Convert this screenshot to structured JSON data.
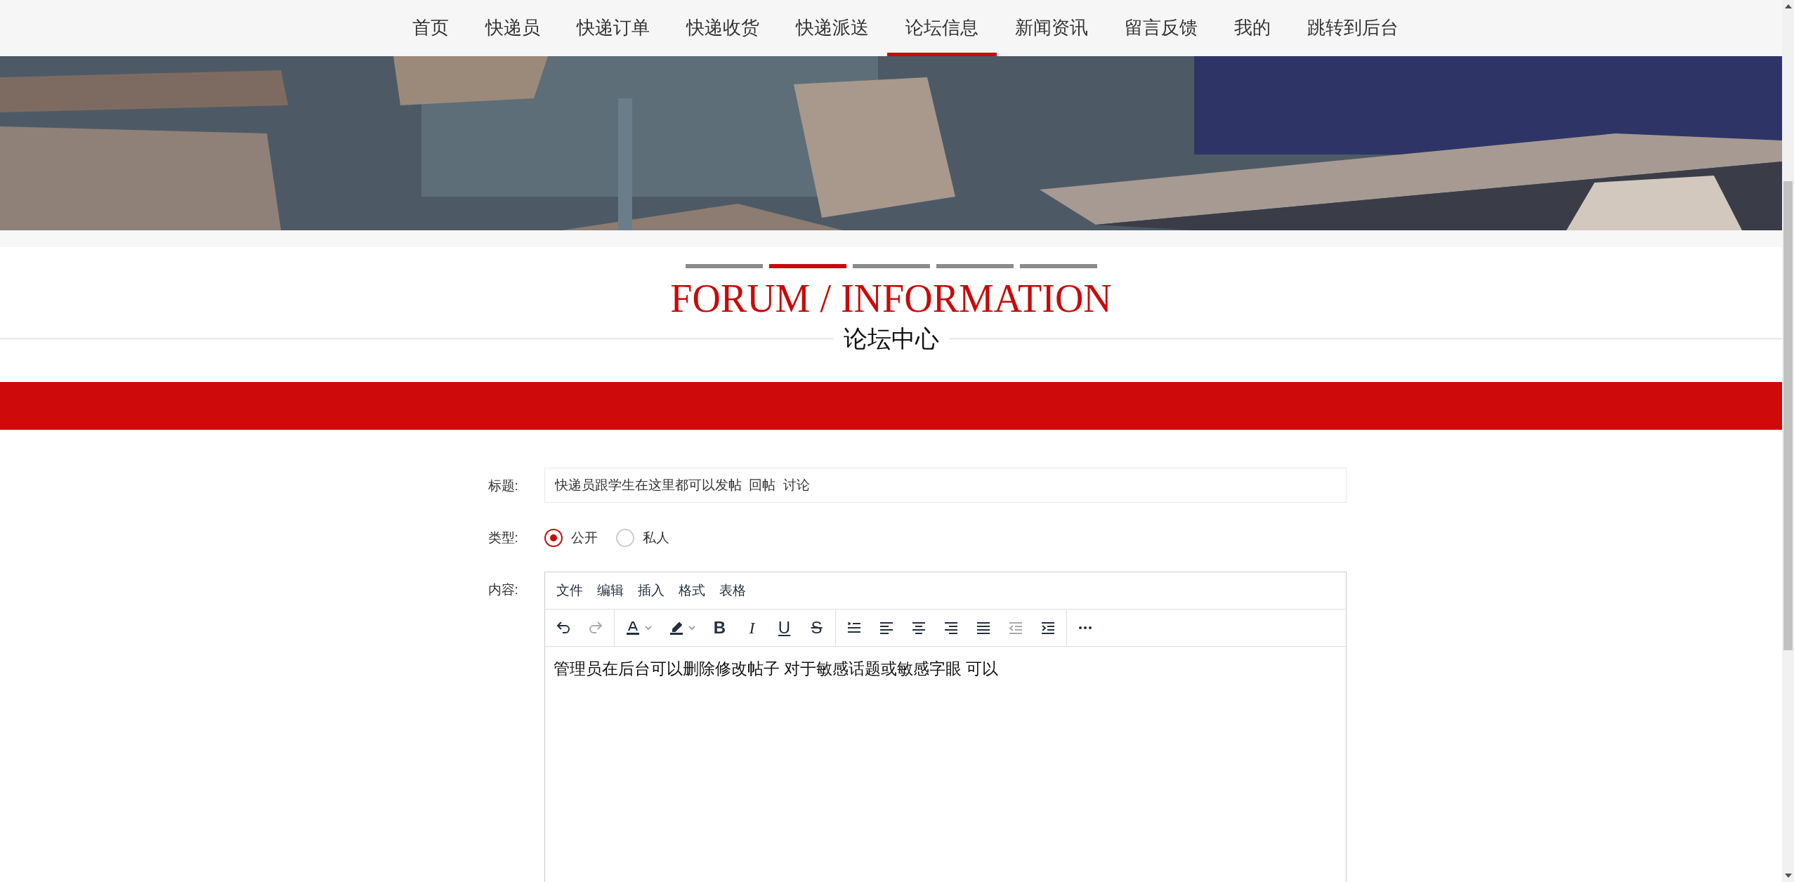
{
  "nav": [
    {
      "label": "首页",
      "selected": false
    },
    {
      "label": "快递员",
      "selected": false
    },
    {
      "label": "快递订单",
      "selected": false
    },
    {
      "label": "快递收货",
      "selected": false
    },
    {
      "label": "快递派送",
      "selected": false
    },
    {
      "label": "论坛信息",
      "selected": true
    },
    {
      "label": "新闻资讯",
      "selected": false
    },
    {
      "label": "留言反馈",
      "selected": false
    },
    {
      "label": "我的",
      "selected": false
    },
    {
      "label": "跳转到后台",
      "selected": false
    }
  ],
  "slide_indicators": [
    {
      "selected": false
    },
    {
      "selected": true
    },
    {
      "selected": false
    },
    {
      "selected": false
    },
    {
      "selected": false
    }
  ],
  "section": {
    "title": "FORUM / INFORMATION",
    "subtitle": "论坛中心"
  },
  "form": {
    "title_label": "标题:",
    "title_value": "快递员跟学生在这里都可以发帖  回帖  讨论",
    "type_label": "类型:",
    "types": [
      {
        "label": "公开",
        "selected": true
      },
      {
        "label": "私人",
        "selected": false
      }
    ],
    "content_label": "内容:",
    "editor": {
      "menu": [
        "文件",
        "编辑",
        "插入",
        "格式",
        "表格"
      ],
      "toolbar": [
        [
          {
            "kind": "undo",
            "disabled": false
          },
          {
            "kind": "redo",
            "disabled": true
          }
        ],
        [
          {
            "kind": "text-color",
            "disabled": false
          },
          {
            "kind": "highlight",
            "disabled": false
          },
          {
            "kind": "bold",
            "label": "B",
            "disabled": false
          },
          {
            "kind": "italic",
            "label": "I",
            "disabled": false
          },
          {
            "kind": "underline",
            "label": "U",
            "disabled": false
          },
          {
            "kind": "strike",
            "label": "S",
            "disabled": false
          }
        ],
        [
          {
            "kind": "line-height",
            "disabled": false
          },
          {
            "kind": "align-left",
            "disabled": false
          },
          {
            "kind": "align-center",
            "disabled": false
          },
          {
            "kind": "align-right",
            "disabled": false
          },
          {
            "kind": "justify",
            "disabled": false
          },
          {
            "kind": "outdent",
            "disabled": true
          },
          {
            "kind": "indent",
            "disabled": false
          }
        ],
        [
          {
            "kind": "more",
            "disabled": false
          }
        ]
      ],
      "content": "管理员在后台可以删除修改帖子 对于敏感话题或敏感字眼 可以"
    }
  }
}
